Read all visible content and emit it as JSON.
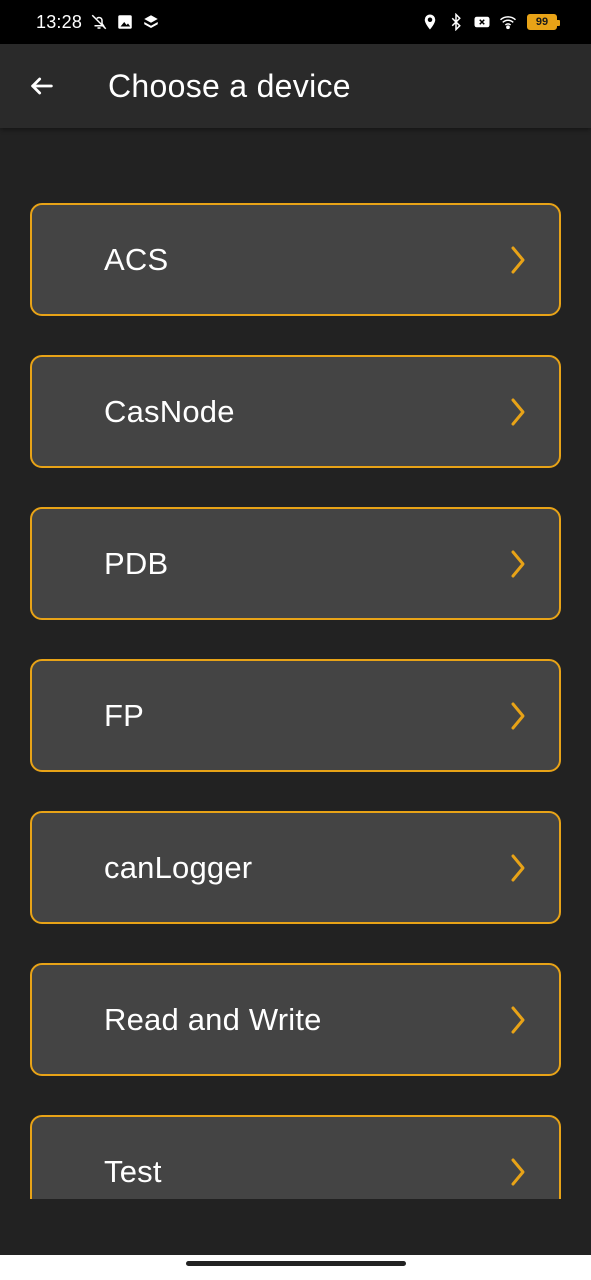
{
  "status_bar": {
    "time": "13:28",
    "battery_level": "99",
    "left_icons": [
      "bell-off-icon",
      "gallery-icon",
      "stack-icon"
    ],
    "right_icons": [
      "location-icon",
      "bluetooth-icon",
      "sim-x-icon",
      "wifi-icon"
    ]
  },
  "app_bar": {
    "back_icon": "arrow-left-icon",
    "title": "Choose a device"
  },
  "devices": [
    {
      "label": "ACS"
    },
    {
      "label": "CasNode"
    },
    {
      "label": "PDB"
    },
    {
      "label": "FP"
    },
    {
      "label": "canLogger"
    },
    {
      "label": "Read and Write"
    },
    {
      "label": "Test"
    }
  ],
  "colors": {
    "accent": "#e8a317",
    "background": "#222222",
    "card": "#444444",
    "app_bar": "#2a2a2a"
  }
}
